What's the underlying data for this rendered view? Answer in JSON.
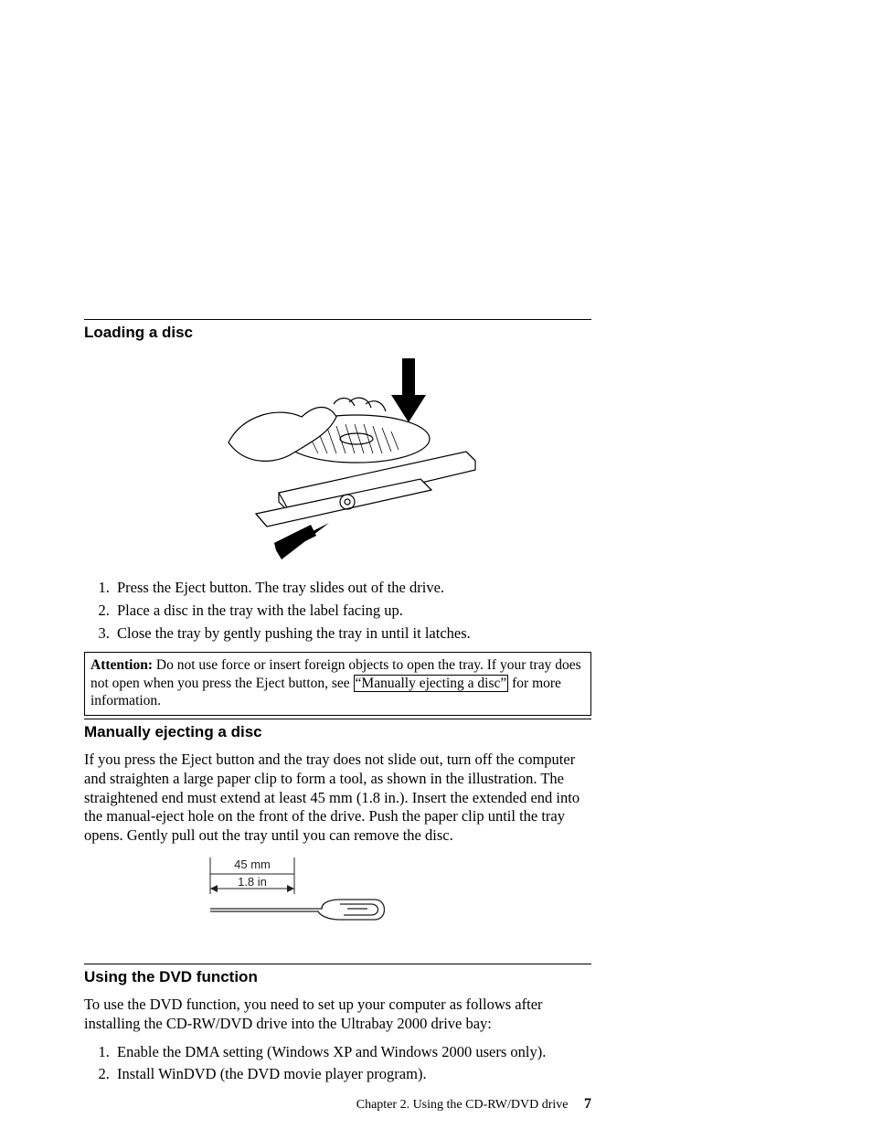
{
  "section1": {
    "heading": "Loading a disc",
    "steps": [
      "Press the Eject button. The tray slides out of the drive.",
      "Place a disc in the tray with the label facing up.",
      "Close the tray by gently pushing the tray in until it latches."
    ],
    "attention_label": "Attention:",
    "attention_before": " Do not use force or insert foreign objects to open the tray. If your tray does not open when you press the Eject button, see ",
    "attention_link": "“Manually ejecting a disc”",
    "attention_after": " for more information."
  },
  "section2": {
    "heading": "Manually ejecting a disc",
    "para": "If you press the Eject button and the tray does not slide out, turn off the computer and straighten a large paper clip to form a tool, as shown in the illustration. The straightened end must extend at least 45 mm (1.8 in.). Insert the extended end into the manual-eject hole on the front of the drive. Push the paper clip until the tray opens. Gently pull out the tray until you can remove the disc.",
    "fig_label_mm": "45 mm",
    "fig_label_in": "1.8 in"
  },
  "section3": {
    "heading": "Using the DVD function",
    "para": "To use the DVD function, you need to set up your computer as follows after installing the CD-RW/DVD drive into the Ultrabay 2000 drive bay:",
    "steps": [
      "Enable the DMA setting (Windows XP and Windows 2000 users only).",
      "Install WinDVD (the DVD movie player program)."
    ]
  },
  "footer": {
    "text": "Chapter 2. Using the CD-RW/DVD drive",
    "page": "7"
  }
}
